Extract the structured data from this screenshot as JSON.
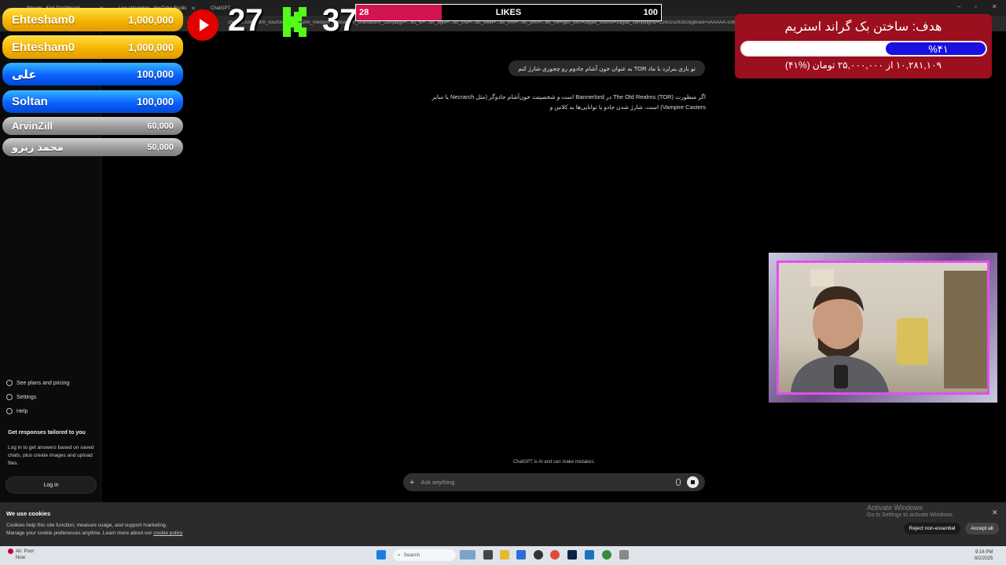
{
  "browser": {
    "tabs": [
      {
        "title": "Stream - Kick Dashboard"
      },
      {
        "title": "Live streaming - YouTube Studio"
      },
      {
        "title": "ChatGPT"
      }
    ],
    "url": "chatgpt.com/?utm_source=google&utm_medium=paidsearch_brand&utm_campaign=...&c_id=...&c_agid=...&c_crid=...&c_kwid=...&c_ims=...&c_pms=...&c_nw=g&c_dvc=c&gad_source=1&gad_campaignid=22601529282&gbraid=0AAAAA-1085b2nWm..."
  },
  "sidebar": {
    "links": [
      {
        "label": "See plans and pricing"
      },
      {
        "label": "Settings"
      },
      {
        "label": "Help"
      }
    ],
    "promo_title": "Get responses tailored to you",
    "promo_text": "Log in to get answers based on saved chats, plus create images and upload files.",
    "login_label": "Log in"
  },
  "chat": {
    "user_message": "تو بازی بنرلرد با ماد TOR  به عنوان خون آشام جادوم رو چجوری شارژ کنم",
    "answer_line1": "اگر منظورت The Old Realms (TOR) در Bannerlord است و شخصیتت خون‌آشام جادوگر (مثل Necrarch یا سایر",
    "answer_line2": "Vampire Casters) است، شارژ شدن جادو یا توانایی‌ها به کلاس و",
    "disclaimer": "ChatGPT is AI and can make mistakes.",
    "composer_placeholder": "Ask anything"
  },
  "cookie": {
    "title": "We use cookies",
    "line1": "Cookies help this site function, measure usage, and support marketing.",
    "line2_prefix": "Manage your cookie preferences anytime. Learn more about our",
    "link": "cookie policy",
    "reject_label": "Reject non-essential",
    "accept_label": "Accept all"
  },
  "activate": {
    "title": "Activate Windows",
    "subtitle": "Go to Settings to activate Windows."
  },
  "taskbar": {
    "weather_line1": "Air: Poor",
    "weather_line2": "Now",
    "search_label": "Search",
    "time": "9:16 PM",
    "date": "8/2/2025"
  },
  "leaderboard": [
    {
      "name": "Ehtesham0",
      "amount": "1,000,000",
      "tier": "gold"
    },
    {
      "name": "Ehtesham0",
      "amount": "1,000,000",
      "tier": "gold"
    },
    {
      "name": "علی",
      "amount": "100,000",
      "tier": "blue"
    },
    {
      "name": "Soltan",
      "amount": "100,000",
      "tier": "blue"
    },
    {
      "name": "ArvinZill",
      "amount": "60,000",
      "tier": "silver"
    },
    {
      "name": "محمد زیزو",
      "amount": "50,000",
      "tier": "silver"
    }
  ],
  "viewers": {
    "youtube": "27",
    "kick": "37"
  },
  "likes": {
    "current": "28",
    "label": "LIKES",
    "target": "100",
    "fraction": 0.28
  },
  "goal": {
    "title": "هدف: ساختن بک گراند استریم",
    "percent_label": "%۴۱",
    "progress": "۱۰,۲۸۱,۱۰۹ از ۲۵,۰۰۰,۰۰۰ تومان (%۴۱)",
    "fraction": 0.41
  },
  "colors": {
    "accent_gold": "#f4b400",
    "accent_blue": "#0b62ff",
    "likes_red": "#d0154f",
    "goal_red": "#9c0f1e",
    "goal_blue": "#1a10e0",
    "kick_green": "#53fc18",
    "youtube_red": "#e30000"
  }
}
